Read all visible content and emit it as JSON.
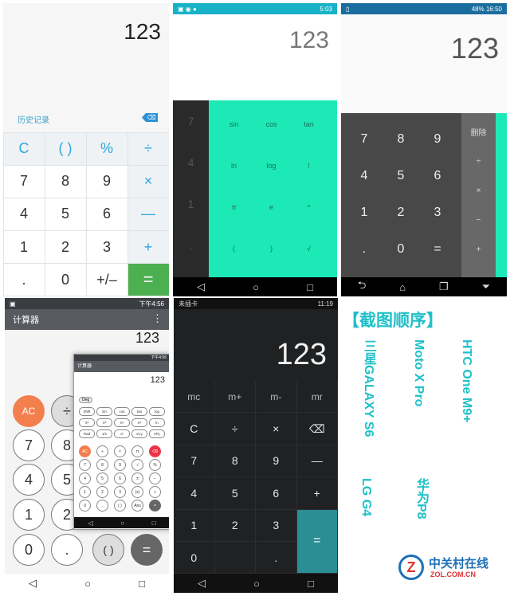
{
  "p1": {
    "display": "123",
    "history": "历史记录",
    "bs": "⌫",
    "keys": [
      [
        "C",
        "( )",
        "%",
        "÷"
      ],
      [
        "7",
        "8",
        "9",
        "×"
      ],
      [
        "4",
        "5",
        "6",
        "—"
      ],
      [
        "1",
        "2",
        "3",
        "+"
      ],
      [
        ".",
        "0",
        "+/–",
        "="
      ]
    ]
  },
  "p2": {
    "status_time": "5:03",
    "display": "123",
    "left_keys": [
      "7",
      "4",
      "1",
      "."
    ],
    "sci_keys": [
      [
        "sin",
        "cos",
        "tan"
      ],
      [
        "ln",
        "log",
        "!"
      ],
      [
        "π",
        "e",
        "^"
      ],
      [
        "(",
        ")",
        "√"
      ]
    ],
    "nav": [
      "◁",
      "○",
      "□"
    ]
  },
  "p3": {
    "status_battery": "48%",
    "status_time": "16:50",
    "display": "123",
    "keys": [
      [
        "7",
        "8",
        "9"
      ],
      [
        "4",
        "5",
        "6"
      ],
      [
        "1",
        "2",
        "3"
      ],
      [
        ".",
        "0",
        "="
      ]
    ],
    "ops": [
      "删除",
      "÷",
      "×",
      "−",
      "+"
    ],
    "nav": [
      "⮌",
      "⌂",
      "❐",
      "⏷"
    ]
  },
  "p4": {
    "status_time": "下午4:56",
    "title": "计算器",
    "display": "123",
    "keys": [
      [
        "AC",
        "÷"
      ],
      [
        "7",
        "8"
      ],
      [
        "4",
        "5"
      ],
      [
        "1",
        "2"
      ],
      [
        "0",
        ".",
        "( )",
        "="
      ]
    ],
    "overlay": {
      "status_time": "下午4:56",
      "title": "计算器",
      "display": "123",
      "deg": "Deg",
      "sci": [
        [
          "Shift",
          "sin",
          "cos",
          "tan",
          "log"
        ],
        [
          "X²",
          "X³",
          "Xʸ",
          "eˣ",
          "ln"
        ],
        [
          "Rad",
          "1/x",
          "x!",
          "xCy",
          "xPy"
        ]
      ],
      "keys": [
        [
          "AC",
          "÷",
          "×",
          "π",
          "⌫"
        ],
        [
          "7",
          "8",
          "9",
          "√",
          "%"
        ],
        [
          "4",
          "5",
          "6",
          "±",
          "−"
        ],
        [
          "1",
          "2",
          "3",
          "|x|",
          "+"
        ],
        [
          "0",
          ".",
          "( )",
          "Ans",
          "="
        ]
      ],
      "nav": [
        "◁",
        "○",
        "□"
      ]
    },
    "nav": [
      "◁",
      "○",
      "□"
    ]
  },
  "p5": {
    "status_left": "未插卡",
    "status_time": "11:19",
    "display": "123",
    "keys": [
      [
        "mc",
        "m+",
        "m-",
        "mr"
      ],
      [
        "C",
        "÷",
        "×",
        "⌫"
      ],
      [
        "7",
        "8",
        "9",
        "—"
      ],
      [
        "4",
        "5",
        "6",
        "+"
      ],
      [
        "1",
        "2",
        "3",
        "="
      ],
      [
        "0",
        "",
        ".",
        ""
      ]
    ],
    "nav": [
      "◁",
      "○",
      "□"
    ]
  },
  "p6": {
    "title": "【截图顺序】",
    "labels": [
      "三星GALAXY S6",
      "Moto X Pro",
      "HTC One M9+",
      "LG G4",
      "华为P8"
    ],
    "logo_main": "中关村在线",
    "logo_sub": "ZOL.COM.CN"
  },
  "colors": {
    "teal": "#1de9b6",
    "green": "#4caf50",
    "orange": "#f47f4e",
    "cyan": "#1ec0c9"
  }
}
